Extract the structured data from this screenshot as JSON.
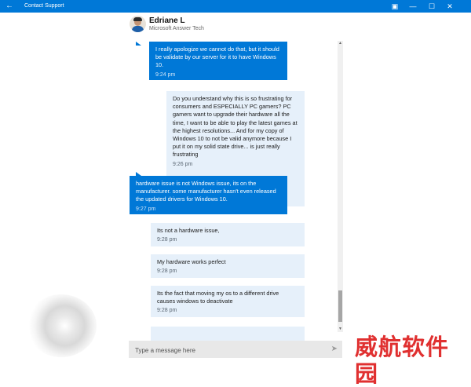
{
  "window": {
    "title": "Contact Support",
    "back_icon": "back-arrow-icon",
    "controls": [
      "pin-icon",
      "minimize-icon",
      "maximize-icon",
      "close-icon"
    ]
  },
  "agent": {
    "name": "Edriane L",
    "role": "Microsoft Answer Tech"
  },
  "messages": [
    {
      "from": "agent",
      "text": "I really apologize we cannot do that, but it should be validate by our server for it to have Windows 10.",
      "time": "9:24 pm"
    },
    {
      "from": "user",
      "text": "Do you understand why this is so frustrating for consumers and ESPECIALLY PC gamers? PC gamers want to upgrade their hardware all the time, I want to be able to play the latest games at the highest resolutions... And for my copy of Windows 10 to not be valid anymore because I put it on my solid state drive... is just really frustrating",
      "time": "9:26 pm"
    },
    {
      "from": "agent",
      "text": "hardware issue is not Windows issue, its on the manufacturer. some manufacturer hasn't even released the updated drivers for Windows 10.",
      "time": "9:27 pm"
    },
    {
      "from": "user",
      "text": "Its not a hardware issue,",
      "time": "9:28 pm"
    },
    {
      "from": "user",
      "text": "My hardware works perfect",
      "time": "9:28 pm"
    },
    {
      "from": "user",
      "text": "Its the fact that moving my os to a different drive causes windows to deactivate",
      "time": "9:28 pm"
    }
  ],
  "composer": {
    "placeholder": "Type a message here",
    "send_icon": "send-icon"
  },
  "watermark": "威航软件园",
  "colors": {
    "accent": "#0078d7",
    "user_bubble": "#e6f0fa",
    "watermark": "#e03030"
  }
}
